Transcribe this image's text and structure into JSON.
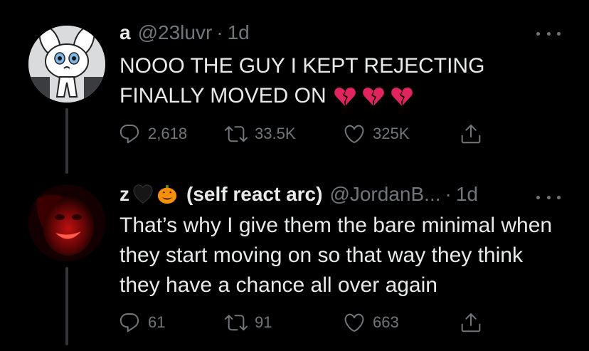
{
  "tweets": [
    {
      "display_name": "a",
      "handle": "@23luvr",
      "dot": "·",
      "time": "1d",
      "text": "NOOO THE GUY I KEPT REJECTING FINALLY MOVED ON",
      "emojis": [
        "broken-heart-icon",
        "broken-heart-icon",
        "broken-heart-icon"
      ],
      "avatar": "white-bunny-cartoon-avatar",
      "replies": "2,618",
      "retweets": "33.5K",
      "likes": "325K"
    },
    {
      "display_name": "z",
      "name_suffix": "(self react arc)",
      "name_emojis": [
        "black-heart-icon",
        "jack-o-lantern-icon"
      ],
      "handle": "@JordanB...",
      "dot": "·",
      "time": "1d",
      "text": "That’s why I give them the bare minimal when they start moving on so that way they think they have a chance all over again",
      "avatar": "red-tinted-face-avatar",
      "replies": "61",
      "retweets": "91",
      "likes": "663"
    }
  ],
  "colors": {
    "background": "#000000",
    "text": "#e7e9ea",
    "secondary": "#71767b",
    "thread_line": "#333639",
    "broken_heart": "#e0245e"
  }
}
